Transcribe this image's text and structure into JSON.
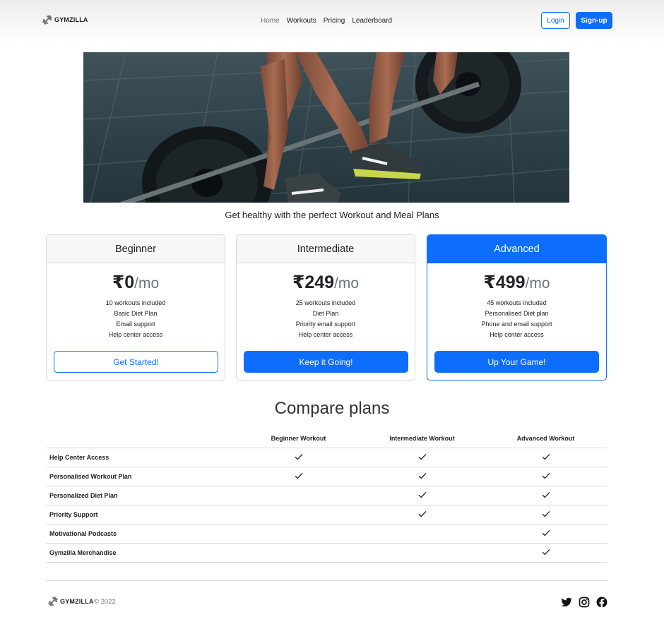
{
  "header": {
    "brand": "GYMZILLA",
    "nav": [
      "Home",
      "Workouts",
      "Pricing",
      "Leaderboard"
    ],
    "login_label": "Login",
    "signup_label": "Sign-up"
  },
  "hero": {
    "tagline": "Get healthy with the perfect Workout and Meal Plans"
  },
  "plans": [
    {
      "name": "Beginner",
      "price": "₹0",
      "period": "/mo",
      "features": [
        "10 workouts included",
        "Basic Diet Plan",
        "Email support",
        "Help center access"
      ],
      "cta": "Get Started!"
    },
    {
      "name": "Intermediate",
      "price": "₹249",
      "period": "/mo",
      "features": [
        "25 workouts included",
        "Diet Plan",
        "Priority email support",
        "Help center access"
      ],
      "cta": "Keep it Going!"
    },
    {
      "name": "Advanced",
      "price": "₹499",
      "period": "/mo",
      "features": [
        "45 workouts included",
        "Personalised Diet plan",
        "Phone and email support",
        "Help center access"
      ],
      "cta": "Up Your Game!"
    }
  ],
  "compare": {
    "title": "Compare plans",
    "columns": [
      "Beginner Workout",
      "Intermediate Workout",
      "Advanced Workout"
    ],
    "rows": [
      {
        "feature": "Help Center Access",
        "checks": [
          true,
          true,
          true
        ]
      },
      {
        "feature": "Personalised Workout Plan",
        "checks": [
          true,
          true,
          true
        ]
      },
      {
        "feature": "Personalized Diet Plan",
        "checks": [
          false,
          true,
          true
        ]
      },
      {
        "feature": "Priority Support",
        "checks": [
          false,
          true,
          true
        ]
      },
      {
        "feature": "Motivational Podcasts",
        "checks": [
          false,
          false,
          true
        ]
      },
      {
        "feature": "Gymzilla Merchandise",
        "checks": [
          false,
          false,
          true
        ]
      }
    ]
  },
  "footer": {
    "brand": "GYMZILLA",
    "copyright": "© 2022",
    "social_icons": [
      "twitter-icon",
      "instagram-icon",
      "facebook-icon"
    ]
  },
  "colors": {
    "accent": "#0d6efd",
    "muted": "#6c757d"
  }
}
